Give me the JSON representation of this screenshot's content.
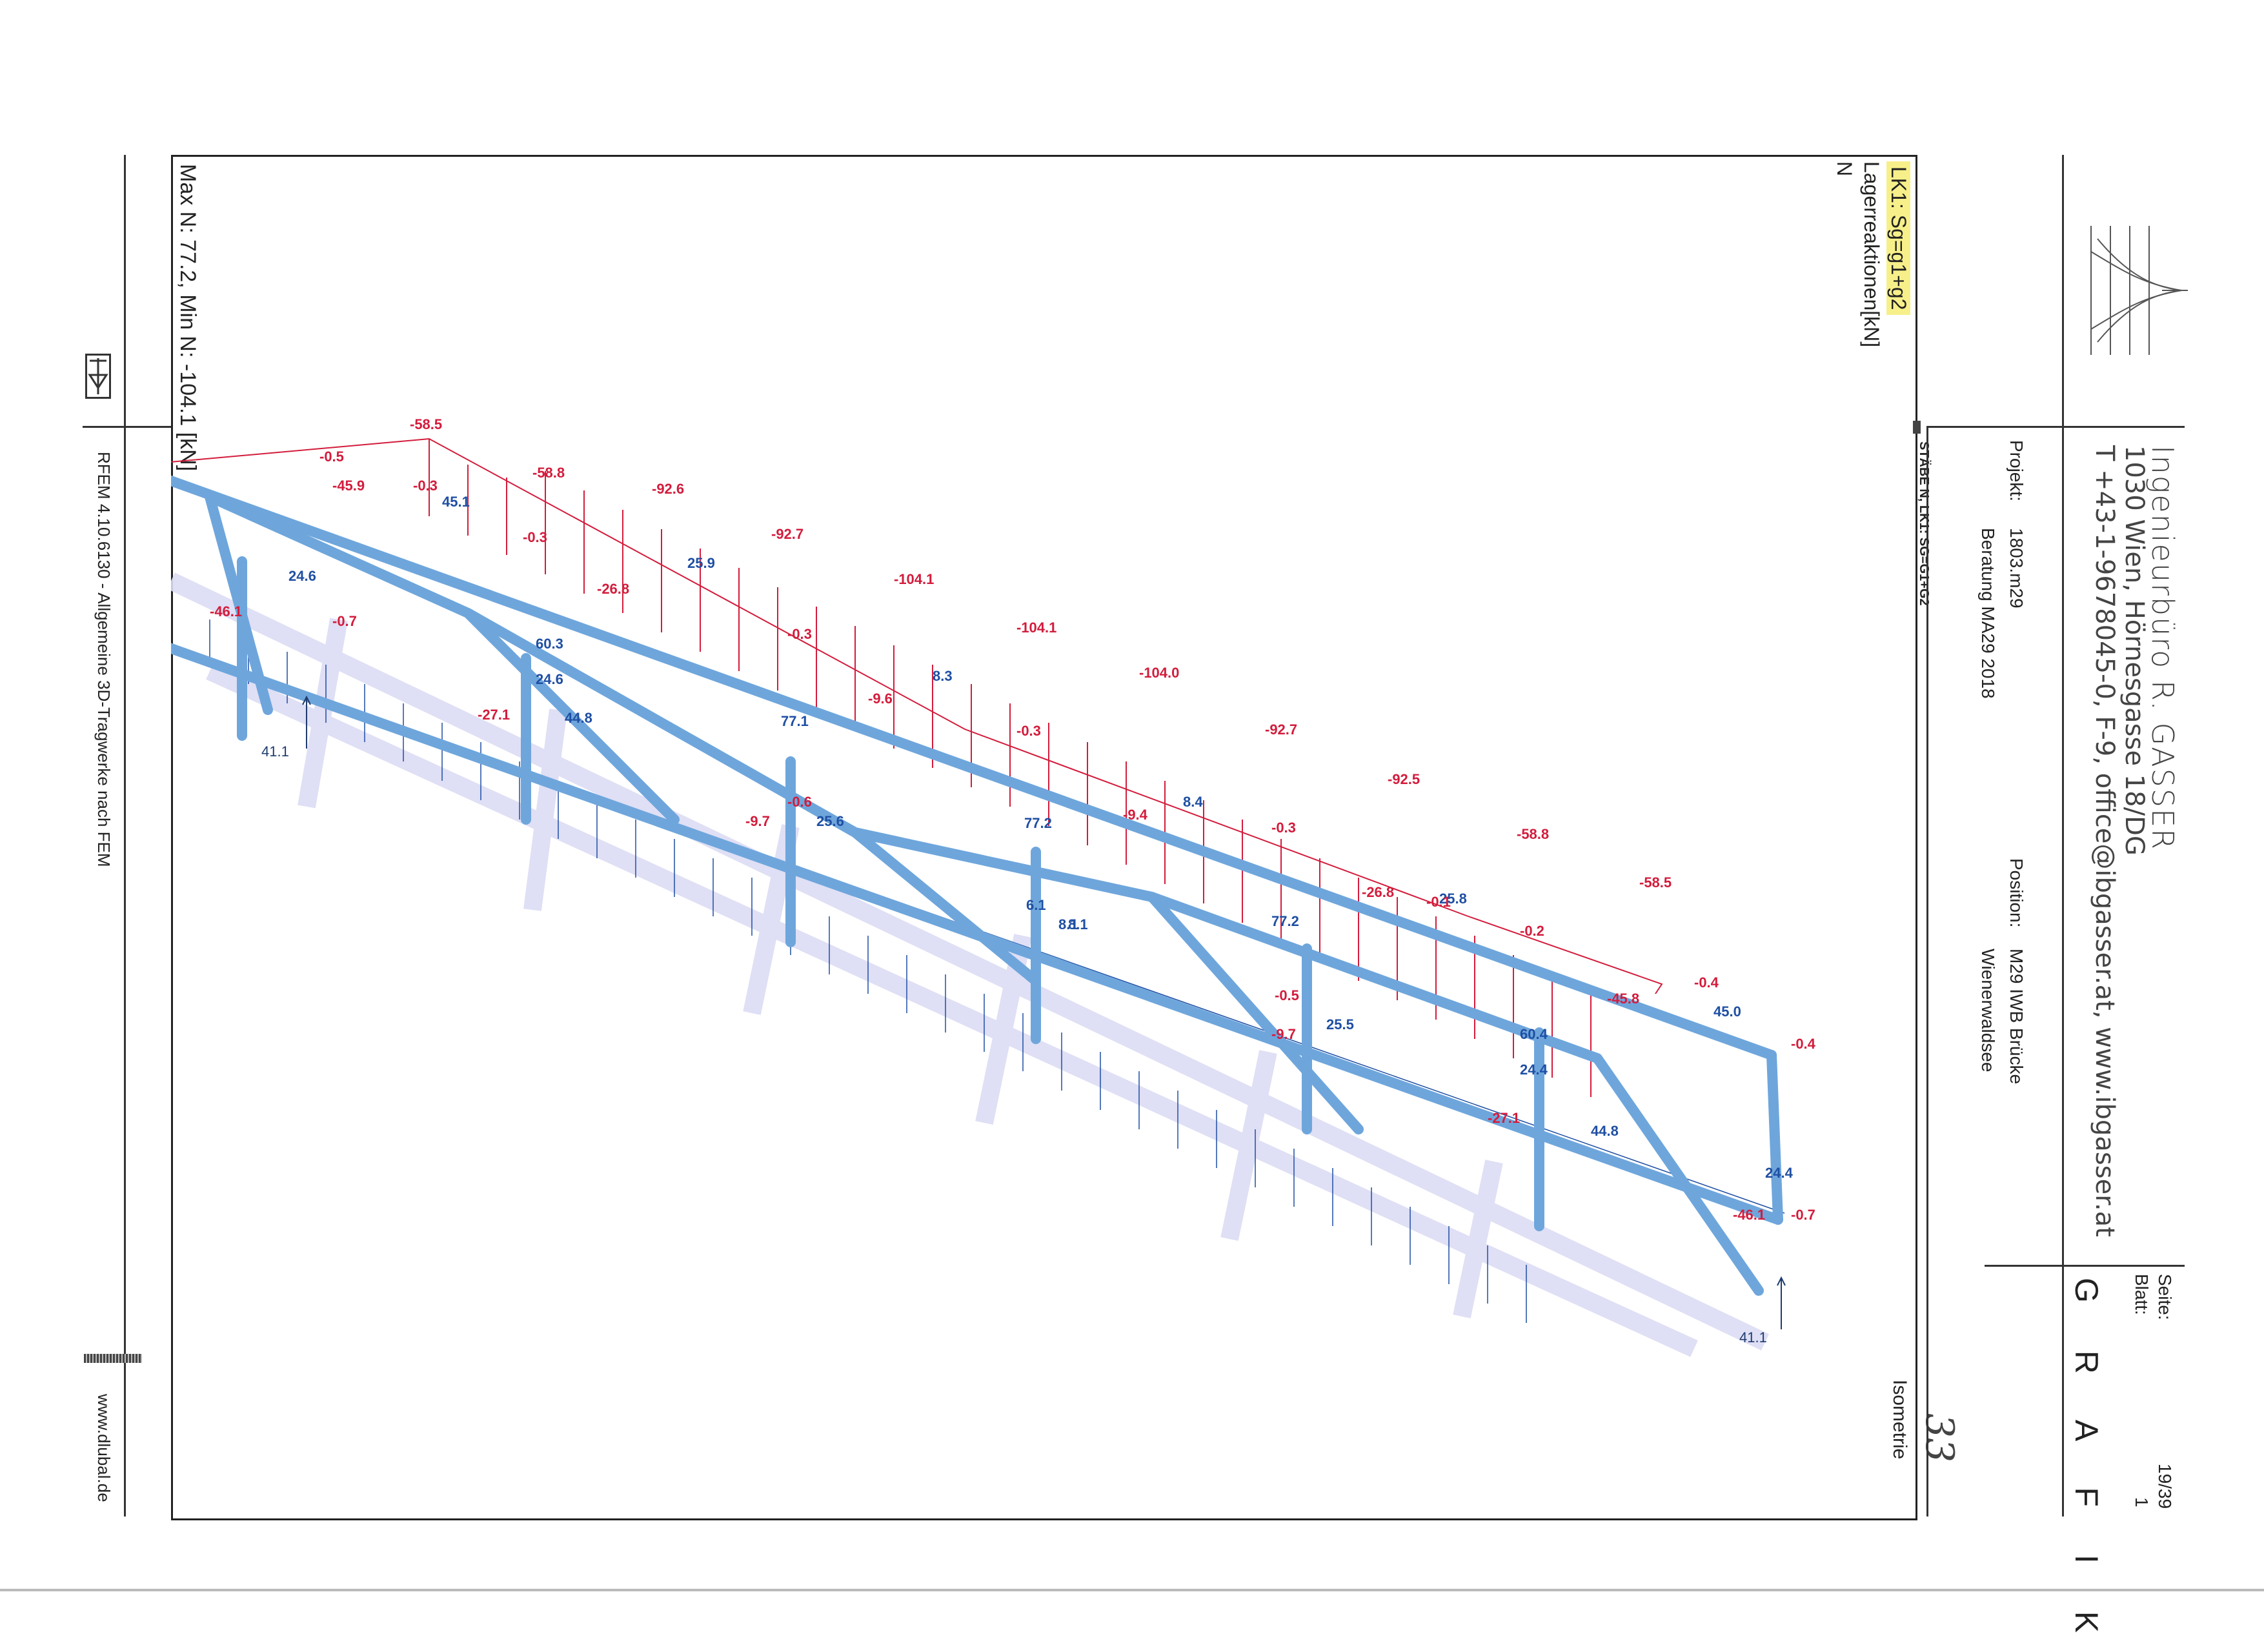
{
  "header": {
    "company": "Ingenieurbüro R. GASSER",
    "address": "1030 Wien, Hörnesgasse 18/DG",
    "contact": "T +43-1-9678045-0, F-9, office@ibgasser.at, www.ibgasser.at",
    "projekt_label": "Projekt:",
    "projekt_value": "1803.m29",
    "projekt_sub": "Beratung MA29 2018",
    "position_label": "Position:",
    "position_value": "M29 IWB Brücke",
    "position_sub": "Wienerwaldsee",
    "seite_label": "Seite:",
    "seite_value": "19/39",
    "blatt_label": "Blatt:",
    "blatt_value": "1",
    "section": "G R A F I K"
  },
  "view": {
    "load_case": "LK1: Sg=g1+g2",
    "result_type": "Lagerreaktionen[kN]",
    "result_unit": "N",
    "tab_label": "STÄBE N, LK1: SG=G1+G2",
    "view_name": "Isometrie",
    "summary": "Max N: 77.2, Min N: -104.1 [kN]",
    "handwritten_page": "33"
  },
  "footer": {
    "software": "RFEM 4.10.6130 - Allgemeine 3D-Tragwerke nach FEM",
    "website": "www.dlubal.de"
  },
  "colors": {
    "compression": "#d31c3c",
    "tension": "#1f4fa3",
    "member": "#6ea6dc",
    "shadow": "#dcdcf4"
  },
  "labels": {
    "top_chord": [
      "-58.5",
      "-58.8",
      "-92.6",
      "-92.7",
      "-104.1",
      "-104.1",
      "-104.0",
      "-92.7",
      "-92.5",
      "-58.8",
      "-58.5"
    ],
    "diagonals": [
      "45.1",
      "-45.9",
      "25.9",
      "-26.8",
      "8.3",
      "-9.6",
      "8.4",
      "-9.4",
      "25.8",
      "-26.8",
      "45.0",
      "-45.8"
    ],
    "verticals": [
      "-0.5",
      "-0.3",
      "-0.3",
      "-0.3",
      "-0.3",
      "-0.3",
      "-0.2",
      "-0.4",
      "-0.4",
      "-0.7",
      "-0.7",
      "-0.6",
      "-0.5",
      "-0.1"
    ],
    "post_axial": [
      "60.3",
      "77.1",
      "77.2",
      "77.2",
      "60.4",
      "24.6",
      "24.4",
      "24.6",
      "24.4",
      "8.1",
      "6.1"
    ],
    "bottom_chord": [
      "44.8",
      "25.6",
      "25.5",
      "44.8",
      "8.1"
    ],
    "bottom_diag": [
      "-27.1",
      "-9.7",
      "-9.7",
      "-27.1"
    ],
    "end_comp": [
      "-46.1",
      "-46.1"
    ],
    "reactions": [
      "41.1",
      "41.1"
    ]
  }
}
